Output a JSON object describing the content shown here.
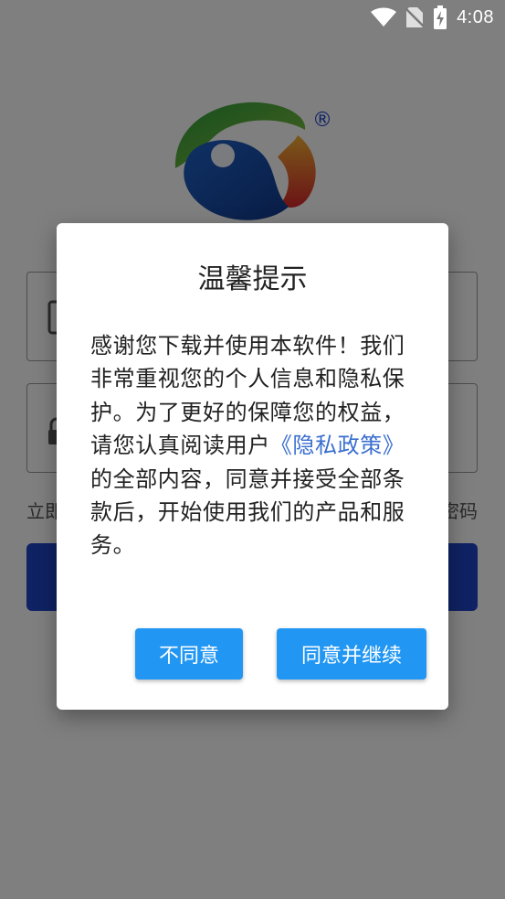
{
  "status_bar": {
    "time": "4:08",
    "icons": [
      "wifi-icon",
      "no-sim-icon",
      "battery-charging-icon"
    ]
  },
  "login_page": {
    "logo_mark": "®",
    "register_partial": "立即",
    "forgot_partial": "密码",
    "account_icon": "phone-icon",
    "password_icon": "lock-icon"
  },
  "dialog": {
    "title": "温馨提示",
    "body_before": "感谢您下载并使用本软件！我们非常重视您的个人信息和隐私保护。为了更好的保障您的权益，请您认真阅读用户",
    "policy_link": "《隐私政策》",
    "body_after": "的全部内容，同意并接受全部条款后，开始使用我们的产品和服务。",
    "disagree_label": "不同意",
    "agree_label": "同意并继续"
  },
  "colors": {
    "primary_button": "#2196f3",
    "link": "#3b6fd0",
    "login_button": "#1f44c9"
  }
}
